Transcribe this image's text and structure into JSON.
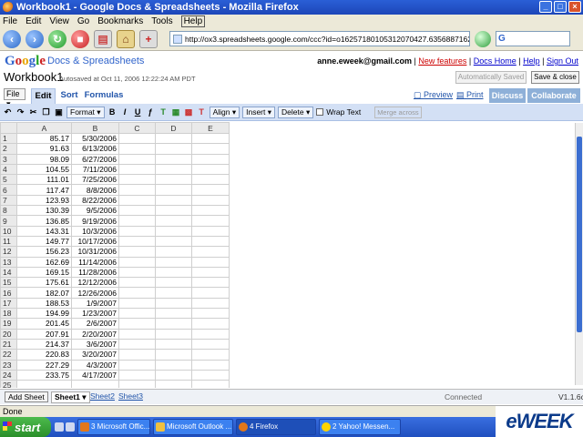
{
  "window": {
    "title": "Workbook1 - Google Docs & Spreadsheets - Mozilla Firefox"
  },
  "menu": [
    "File",
    "Edit",
    "View",
    "Go",
    "Bookmarks",
    "Tools",
    "Help"
  ],
  "browser": {
    "url": "http://ox3.spreadsheets.google.com/ccc?id=o16257180105312070427.6356887162907643573.0",
    "search_placeholder": "G"
  },
  "header": {
    "logo": "Google",
    "product": "Docs & Spreadsheets",
    "user_email": "anne.eweek@gmail.com",
    "links": [
      "New features",
      "Docs Home",
      "Help",
      "Sign Out"
    ],
    "doc_title": "Workbook1",
    "autosave": "Autosaved at Oct 11, 2006 12:22:24 AM PDT",
    "btn_autosave": "Automatically Saved",
    "btn_save_close": "Save & close"
  },
  "tabs": {
    "file": "File",
    "items": [
      "Edit",
      "Sort",
      "Formulas"
    ],
    "preview": "Preview",
    "print": "Print",
    "discuss": "Discuss",
    "collaborate": "Collaborate"
  },
  "toolbar": {
    "format": "Format",
    "align": "Align",
    "insert": "Insert",
    "delete": "Delete",
    "wrap_text": "Wrap Text",
    "merge_across": "Merge across"
  },
  "grid": {
    "columns": [
      "A",
      "B",
      "C",
      "D",
      "E"
    ],
    "rows": [
      {
        "n": "1",
        "a": "85.17",
        "b": "5/30/2006"
      },
      {
        "n": "2",
        "a": "91.63",
        "b": "6/13/2006"
      },
      {
        "n": "3",
        "a": "98.09",
        "b": "6/27/2006"
      },
      {
        "n": "4",
        "a": "104.55",
        "b": "7/11/2006"
      },
      {
        "n": "5",
        "a": "111.01",
        "b": "7/25/2006"
      },
      {
        "n": "6",
        "a": "117.47",
        "b": "8/8/2006"
      },
      {
        "n": "7",
        "a": "123.93",
        "b": "8/22/2006"
      },
      {
        "n": "8",
        "a": "130.39",
        "b": "9/5/2006"
      },
      {
        "n": "9",
        "a": "136.85",
        "b": "9/19/2006"
      },
      {
        "n": "10",
        "a": "143.31",
        "b": "10/3/2006"
      },
      {
        "n": "11",
        "a": "149.77",
        "b": "10/17/2006"
      },
      {
        "n": "12",
        "a": "156.23",
        "b": "10/31/2006"
      },
      {
        "n": "13",
        "a": "162.69",
        "b": "11/14/2006"
      },
      {
        "n": "14",
        "a": "169.15",
        "b": "11/28/2006"
      },
      {
        "n": "15",
        "a": "175.61",
        "b": "12/12/2006"
      },
      {
        "n": "16",
        "a": "182.07",
        "b": "12/26/2006"
      },
      {
        "n": "17",
        "a": "188.53",
        "b": "1/9/2007"
      },
      {
        "n": "18",
        "a": "194.99",
        "b": "1/23/2007"
      },
      {
        "n": "19",
        "a": "201.45",
        "b": "2/6/2007"
      },
      {
        "n": "20",
        "a": "207.91",
        "b": "2/20/2007"
      },
      {
        "n": "21",
        "a": "214.37",
        "b": "3/6/2007"
      },
      {
        "n": "22",
        "a": "220.83",
        "b": "3/20/2007"
      },
      {
        "n": "23",
        "a": "227.29",
        "b": "4/3/2007"
      },
      {
        "n": "24",
        "a": "233.75",
        "b": "4/17/2007"
      },
      {
        "n": "25",
        "a": "",
        "b": ""
      }
    ]
  },
  "sheets": {
    "add_sheet": "Add Sheet",
    "tabs": [
      "Sheet1",
      "Sheet2",
      "Sheet3"
    ],
    "status": "Connected",
    "version": "V1.1.6c"
  },
  "statusbar": "Done",
  "taskbar": {
    "start": "start",
    "tasks": [
      "3 Microsoft Offic...",
      "Microsoft Outlook ...",
      "4 Firefox",
      "2 Yahoo! Messen..."
    ]
  },
  "watermark": "eWEEK"
}
